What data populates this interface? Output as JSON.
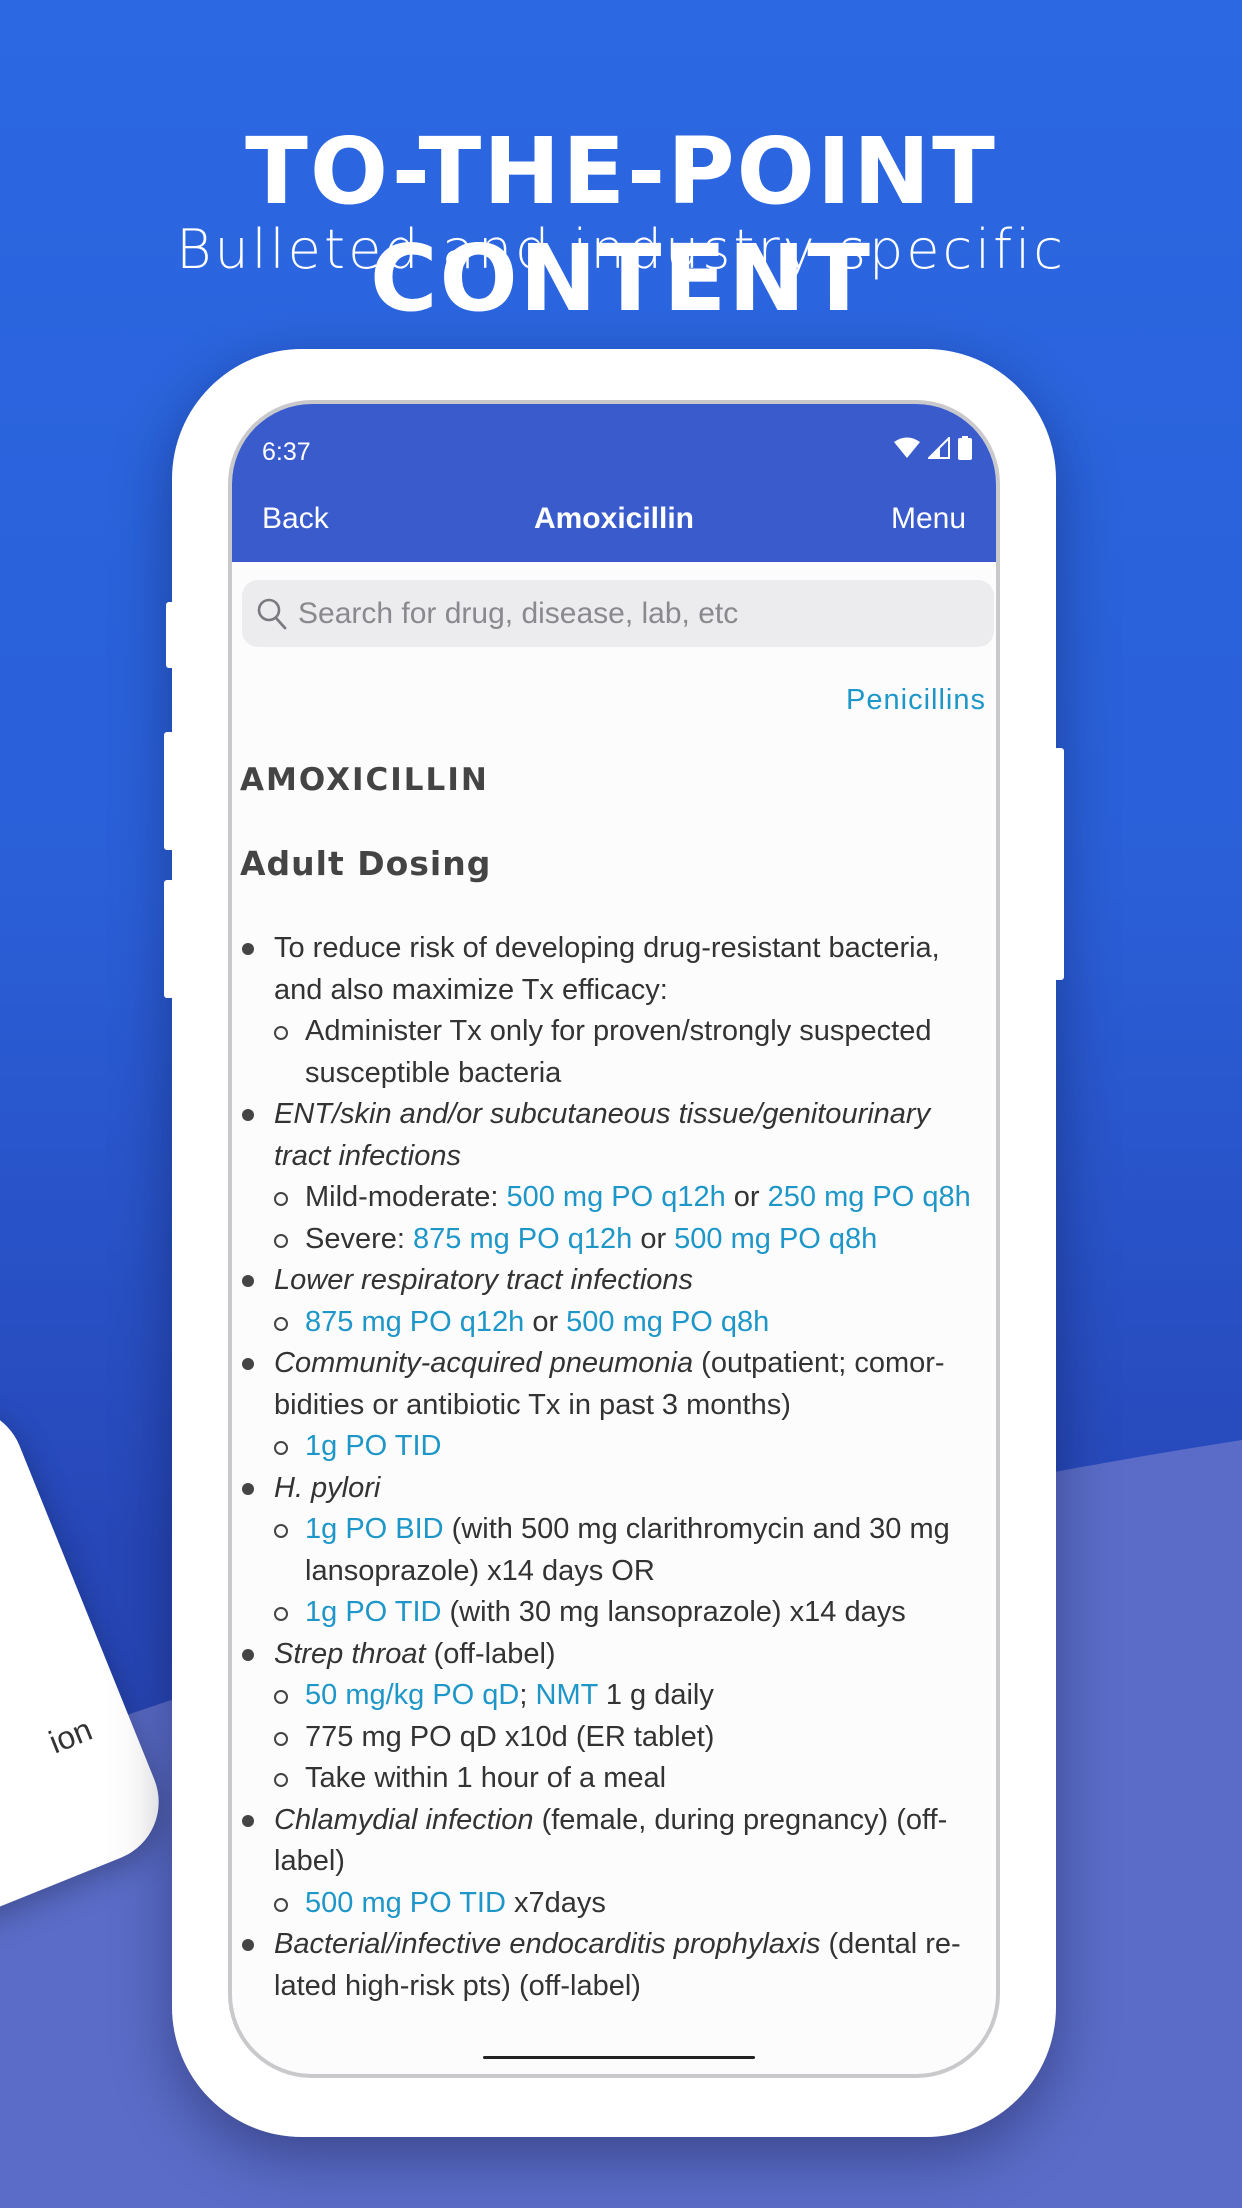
{
  "promo": {
    "headline": "TO-THE-POINT CONTENT",
    "subline": "Bulleted and industry specific",
    "side_device_text": "ion"
  },
  "colors": {
    "header": "#3a5bcc",
    "link": "#1e97c8",
    "background": "#2b68e2"
  },
  "status_bar": {
    "time": "6:37",
    "icons": [
      "wifi-icon",
      "signal-icon",
      "battery-icon"
    ]
  },
  "nav": {
    "back": "Back",
    "title": "Amoxicillin",
    "menu": "Menu"
  },
  "search": {
    "placeholder": "Search for drug, disease, lab, etc",
    "icon": "search-icon"
  },
  "category": "Penicillins",
  "drug_title": "AMOXICILLIN",
  "section_title": "Adult Dosing",
  "items": [
    {
      "level": 1,
      "parts": [
        {
          "t": "To reduce risk of developing drug-resistant bacteria, and also maximize Tx efficacy:"
        }
      ]
    },
    {
      "level": 2,
      "parts": [
        {
          "t": "Administer Tx only for proven/strongly suspected susceptible bacteria"
        }
      ]
    },
    {
      "level": 1,
      "parts": [
        {
          "t": "ENT/skin and/or subcutaneous tissue/genitourinary tract infections",
          "s": "i"
        }
      ]
    },
    {
      "level": 2,
      "parts": [
        {
          "t": "Mild-moderate: "
        },
        {
          "t": "500 mg PO q12h",
          "s": "link"
        },
        {
          "t": " or "
        },
        {
          "t": "250 mg PO q8h",
          "s": "link"
        }
      ]
    },
    {
      "level": 2,
      "parts": [
        {
          "t": "Severe: "
        },
        {
          "t": "875 mg PO q12h",
          "s": "link"
        },
        {
          "t": " or "
        },
        {
          "t": "500 mg PO q8h",
          "s": "link"
        }
      ]
    },
    {
      "level": 1,
      "parts": [
        {
          "t": "Lower respiratory tract infections",
          "s": "i"
        }
      ]
    },
    {
      "level": 2,
      "parts": [
        {
          "t": "875 mg PO q12h",
          "s": "link"
        },
        {
          "t": " or "
        },
        {
          "t": "500 mg PO q8h",
          "s": "link"
        }
      ]
    },
    {
      "level": 1,
      "parts": [
        {
          "t": "Community-acquired pneumonia",
          "s": "i"
        },
        {
          "t": " (outpatient; comor-bidities or antibiotic Tx in past 3 months)"
        }
      ]
    },
    {
      "level": 2,
      "parts": [
        {
          "t": "1g PO TID",
          "s": "link"
        }
      ]
    },
    {
      "level": 1,
      "parts": [
        {
          "t": "H. pylori",
          "s": "i"
        }
      ]
    },
    {
      "level": 2,
      "parts": [
        {
          "t": "1g PO BID",
          "s": "link"
        },
        {
          "t": " (with 500 mg clarithromycin and 30 mg lansoprazole) x14 days OR"
        }
      ]
    },
    {
      "level": 2,
      "parts": [
        {
          "t": "1g PO TID",
          "s": "link"
        },
        {
          "t": " (with 30 mg lansoprazole) x14 days"
        }
      ]
    },
    {
      "level": 1,
      "parts": [
        {
          "t": "Strep throat",
          "s": "i"
        },
        {
          "t": " (off-label)"
        }
      ]
    },
    {
      "level": 2,
      "parts": [
        {
          "t": "50 mg/kg PO qD",
          "s": "link"
        },
        {
          "t": "; "
        },
        {
          "t": "NMT",
          "s": "link"
        },
        {
          "t": " 1 g daily"
        }
      ]
    },
    {
      "level": 2,
      "parts": [
        {
          "t": "775 mg PO qD x10d (ER tablet)"
        }
      ]
    },
    {
      "level": 2,
      "parts": [
        {
          "t": "Take within 1 hour of a meal"
        }
      ]
    },
    {
      "level": 1,
      "parts": [
        {
          "t": "Chlamydial infection",
          "s": "i"
        },
        {
          "t": " (female, during pregnancy) (off-label)"
        }
      ]
    },
    {
      "level": 2,
      "parts": [
        {
          "t": "500 mg PO TID",
          "s": "link"
        },
        {
          "t": " x7days"
        }
      ]
    },
    {
      "level": 1,
      "parts": [
        {
          "t": "Bacterial/infective endocarditis prophylaxis",
          "s": "i"
        },
        {
          "t": " (dental re-lated high-risk pts) (off-label)"
        }
      ]
    }
  ]
}
